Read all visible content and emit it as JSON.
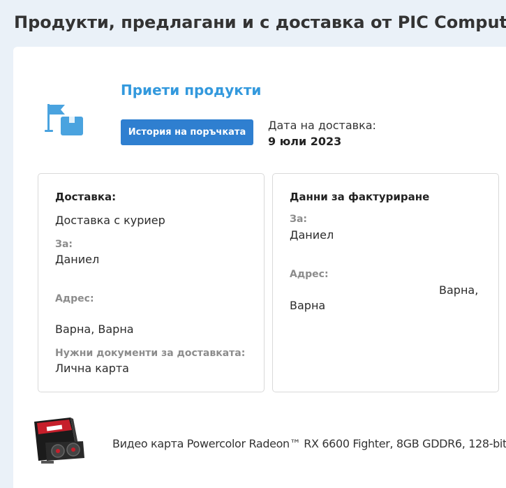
{
  "page": {
    "title": "Продукти, предлагани и с доставка от PIC Computer"
  },
  "order": {
    "status_title": "Приети продукти",
    "status_icon": "flag-box-icon",
    "history_button_label": "История на поръчката",
    "delivery_date_label": "Дата на доставка:",
    "delivery_date": "9 юли 2023"
  },
  "delivery": {
    "heading": "Доставка:",
    "method": "Доставка с куриер",
    "for_label": "За:",
    "recipient": "Даниел",
    "address_label": "Адрес:",
    "address": "Варна, Варна",
    "documents_label": "Нужни документи за доставката:",
    "documents": "Лична карта"
  },
  "billing": {
    "heading": "Данни за фактуриране",
    "for_label": "За:",
    "name": "Даниел",
    "address_label": "Адрес:",
    "address_line1": "Варна,",
    "address_line2": "Варна"
  },
  "product": {
    "name": "Видео карта Powercolor Radeon™ RX 6600 Fighter, 8GB GDDR6, 128-bit",
    "image_icon": "graphics-card-box-image"
  },
  "colors": {
    "accent": "#3399dd",
    "button": "#2f7fd0",
    "background": "#eaf1f8"
  }
}
